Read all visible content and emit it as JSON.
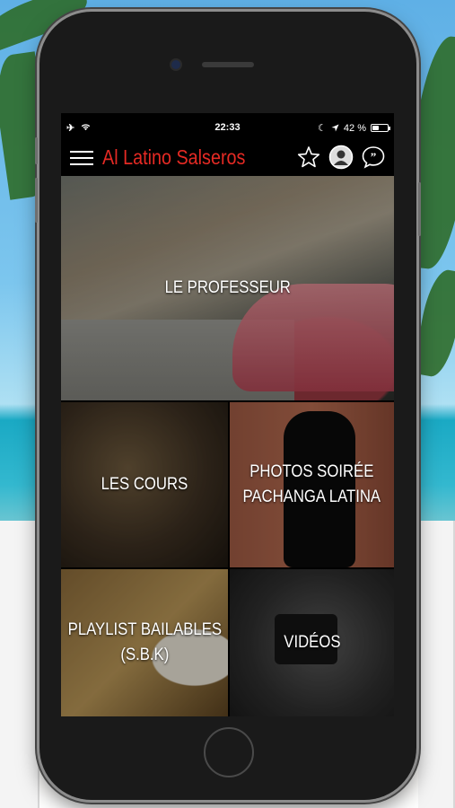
{
  "status_bar": {
    "time": "22:33",
    "battery": "42 %",
    "battery_level": 0.42,
    "left_icons": [
      "airplane-icon",
      "wifi-icon"
    ],
    "right_icons": [
      "moon-icon",
      "location-arrow-icon",
      "battery-icon"
    ]
  },
  "header": {
    "title": "Al Latino Salseros",
    "title_color": "#e52a24",
    "menu_icon": "hamburger-menu-icon",
    "action_icons": [
      "star-icon",
      "profile-avatar-icon",
      "chat-quote-icon"
    ]
  },
  "tiles": [
    {
      "label": "LE PROFESSEUR"
    },
    {
      "label": "LES COURS"
    },
    {
      "label_line1": "PHOTOS SOIRÉE",
      "label_line2": "PACHANGA LATINA"
    },
    {
      "label_line1": "PLAYLIST BAILABLES",
      "label_line2": "(S.B.K)"
    },
    {
      "label": "VIDÉOS"
    }
  ]
}
